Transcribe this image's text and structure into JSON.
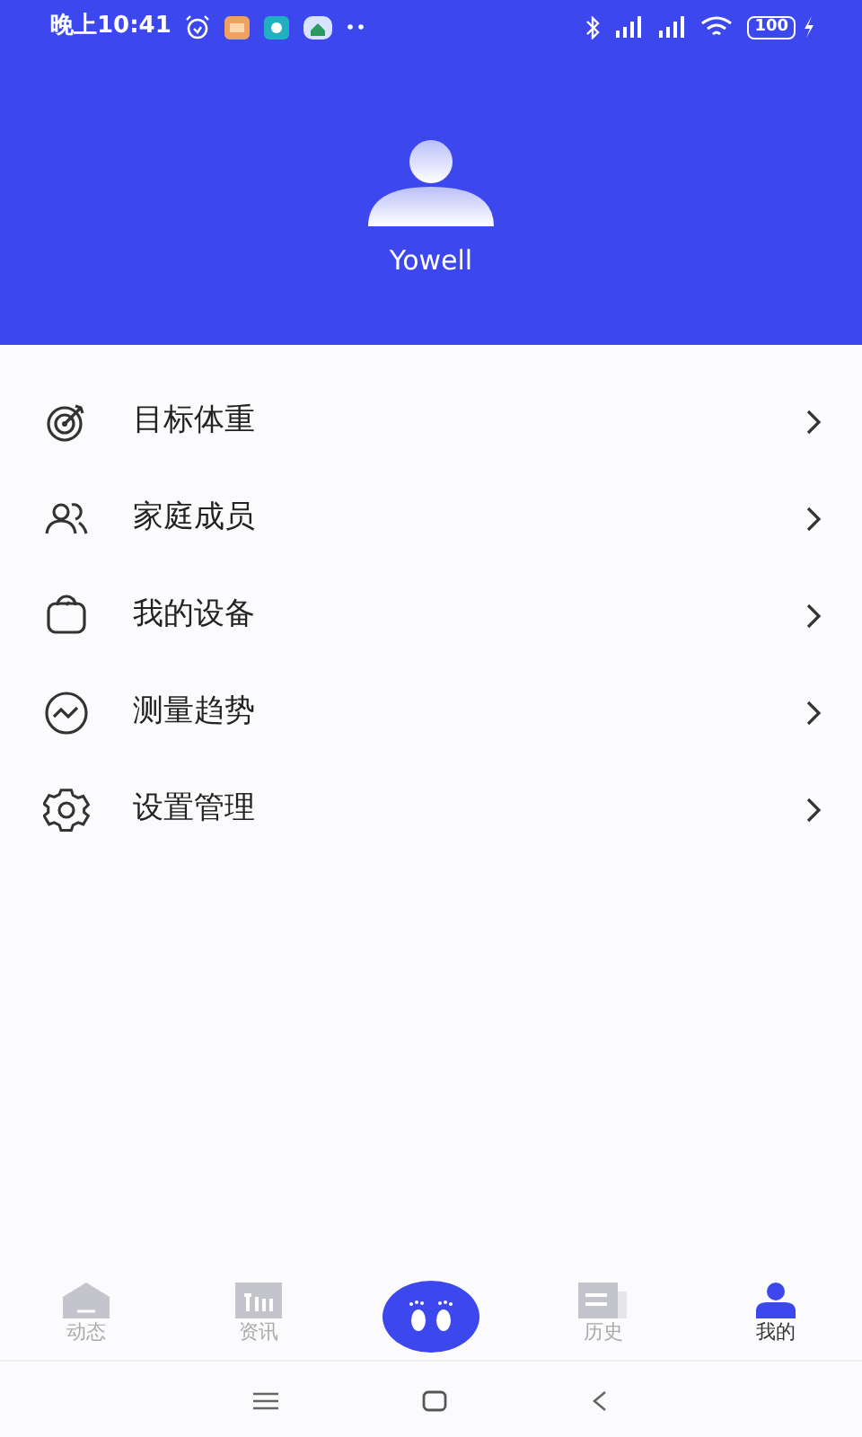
{
  "status_bar": {
    "time": "晚上10:41",
    "battery": "100"
  },
  "profile": {
    "name": "Yowell"
  },
  "menu": [
    {
      "kind": "target",
      "label": "目标体重"
    },
    {
      "kind": "family",
      "label": "家庭成员"
    },
    {
      "kind": "scale",
      "label": "我的设备"
    },
    {
      "kind": "trend",
      "label": "测量趋势"
    },
    {
      "kind": "settings",
      "label": "设置管理"
    }
  ],
  "tab_bar": [
    {
      "kind": "home",
      "label": "动态",
      "selected": false
    },
    {
      "kind": "news",
      "label": "资讯",
      "selected": false
    },
    {
      "kind": "measure",
      "selected": false
    },
    {
      "kind": "history",
      "label": "历史",
      "selected": false
    },
    {
      "kind": "me",
      "label": "我的",
      "selected": true
    }
  ]
}
